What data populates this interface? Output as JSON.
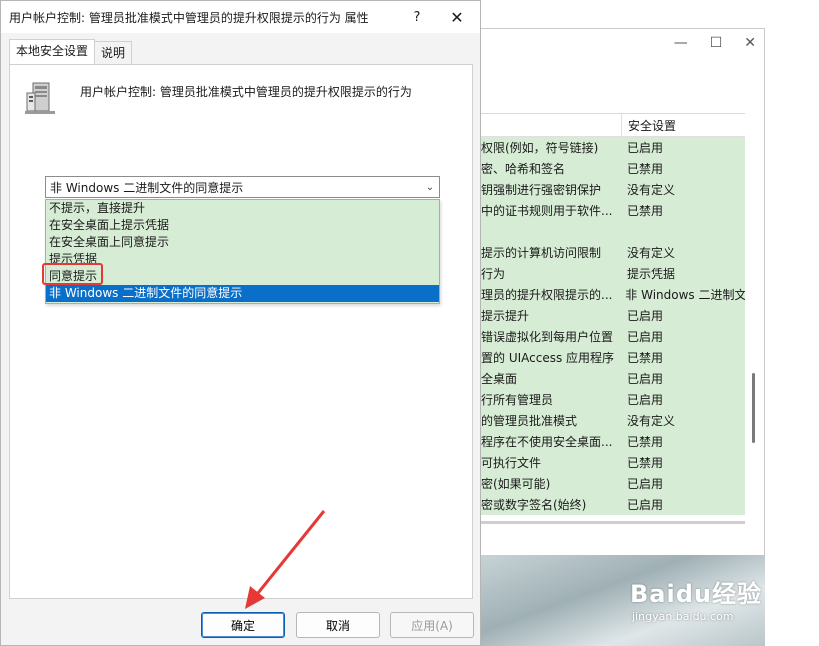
{
  "dialog": {
    "title": "用户帐户控制: 管理员批准模式中管理员的提升权限提示的行为 属性",
    "help_glyph": "?",
    "close_glyph": "✕",
    "tabs": [
      {
        "label": "本地安全设置",
        "active": true
      },
      {
        "label": "说明",
        "active": false
      }
    ],
    "policy_name": "用户帐户控制: 管理员批准模式中管理员的提升权限提示的行为",
    "combo_value": "非 Windows 二进制文件的同意提示",
    "options": [
      {
        "label": "不提示，直接提升",
        "selected": false
      },
      {
        "label": "在安全桌面上提示凭据",
        "selected": false
      },
      {
        "label": "在安全桌面上同意提示",
        "selected": false
      },
      {
        "label": "提示凭据",
        "selected": false
      },
      {
        "label": "同意提示",
        "selected": false,
        "highlighted": true
      },
      {
        "label": "非 Windows 二进制文件的同意提示",
        "selected": true
      }
    ],
    "buttons": {
      "ok": "确定",
      "cancel": "取消",
      "apply": "应用(A)"
    }
  },
  "background_window": {
    "column_header": "安全设置",
    "rows": [
      {
        "policy": "权限(例如，符号链接)",
        "setting": "已启用"
      },
      {
        "policy": "密、哈希和签名",
        "setting": "已禁用"
      },
      {
        "policy": "钥强制进行强密钥保护",
        "setting": "没有定义"
      },
      {
        "policy": "中的证书规则用于软件...",
        "setting": "已禁用"
      },
      {
        "policy": "",
        "setting": ""
      },
      {
        "policy": "提示的计算机访问限制",
        "setting": "没有定义"
      },
      {
        "policy": "行为",
        "setting": "提示凭据"
      },
      {
        "policy": "理员的提升权限提示的...",
        "setting": "非 Windows 二进制文"
      },
      {
        "policy": "提示提升",
        "setting": "已启用"
      },
      {
        "policy": "错误虚拟化到每用户位置",
        "setting": "已启用"
      },
      {
        "policy": "置的 UIAccess 应用程序",
        "setting": "已禁用"
      },
      {
        "policy": "全桌面",
        "setting": "已启用"
      },
      {
        "policy": "行所有管理员",
        "setting": "已启用"
      },
      {
        "policy": "的管理员批准模式",
        "setting": "没有定义"
      },
      {
        "policy": "程序在不使用安全桌面...",
        "setting": "已禁用"
      },
      {
        "policy": "可执行文件",
        "setting": "已禁用"
      },
      {
        "policy": "密(如果可能)",
        "setting": "已启用"
      },
      {
        "policy": "密或数字签名(始终)",
        "setting": "已启用"
      }
    ],
    "controls": {
      "minimize": "—",
      "maximize": "☐",
      "close": "✕"
    }
  },
  "watermark": {
    "main": "Baidu经验",
    "sub": "jingyan.baidu.com"
  },
  "colors": {
    "list_green": "#d6ecd4",
    "selection_blue": "#0a6fc9",
    "annotation_red": "#e53935"
  }
}
